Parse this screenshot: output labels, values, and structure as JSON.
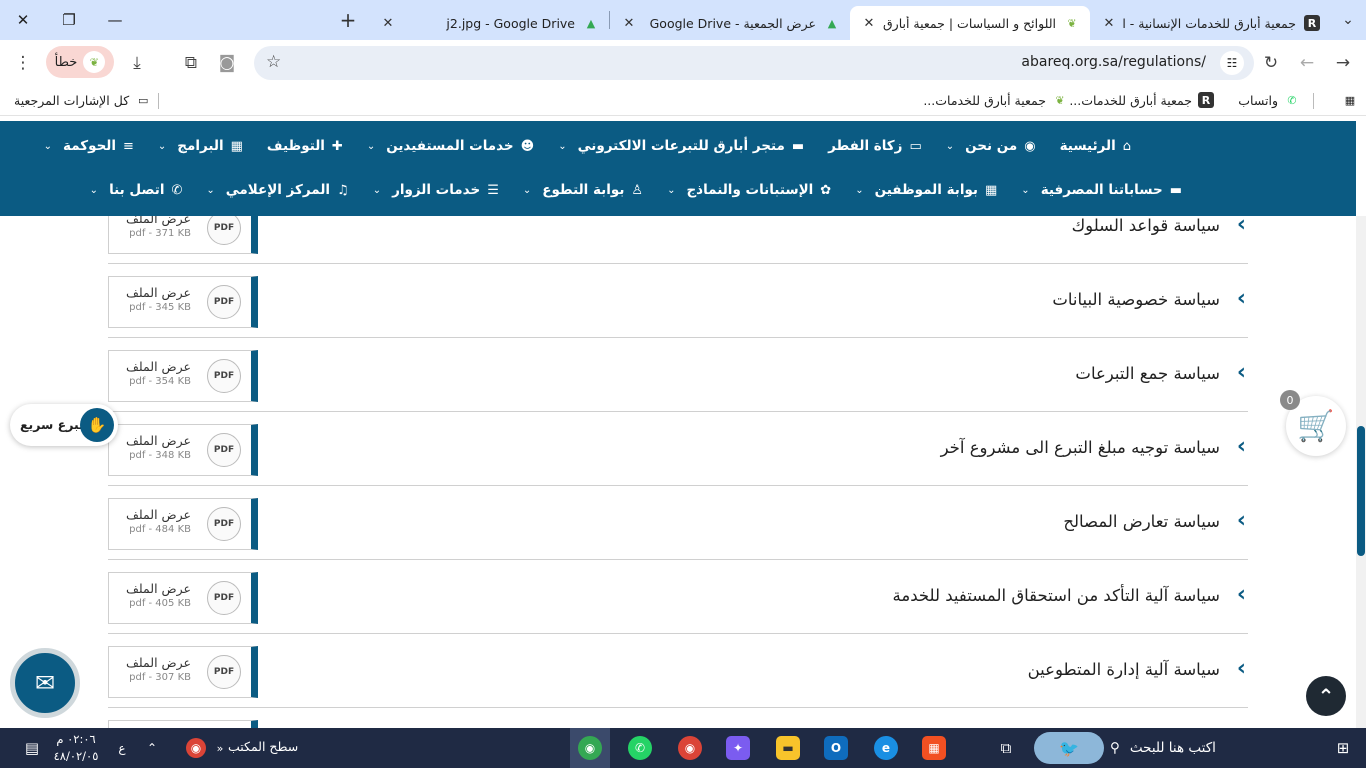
{
  "browser": {
    "tabs": [
      {
        "title": "جمعية أبارق للخدمات الإنسانية - ا",
        "active": false
      },
      {
        "title": "اللوائح و السياسات | جمعية أبارق ا",
        "active": true
      },
      {
        "title": "عرض الجمعية - Google Drive",
        "active": false
      },
      {
        "title": "j2.jpg - Google Drive",
        "active": false
      }
    ],
    "url": "abareq.org.sa/regulations/",
    "error_label": "خطأ",
    "bookmarks": {
      "whatsapp": "واتساب",
      "bm1": "جمعية أبارق للخدمات...",
      "bm2": "جمعية أبارق للخدمات...",
      "all": "كل الإشارات المرجعية"
    }
  },
  "nav": {
    "row1": [
      {
        "label": "الرئيسية",
        "icon": "⌂"
      },
      {
        "label": "من نحن",
        "icon": "◉",
        "dropdown": true
      },
      {
        "label": "زكاة الفطر",
        "icon": "▭"
      },
      {
        "label": "متجر أبارق للتبرعات الالكتروني",
        "icon": "▬",
        "dropdown": true
      },
      {
        "label": "خدمات المستفيدين",
        "icon": "☻",
        "dropdown": true
      },
      {
        "label": "التوظيف",
        "icon": "✚"
      },
      {
        "label": "البرامج",
        "icon": "▦",
        "dropdown": true
      },
      {
        "label": "الحوكمة",
        "icon": "≡",
        "dropdown": true
      }
    ],
    "row2": [
      {
        "label": "حساباتنا المصرفية",
        "icon": "▬",
        "dropdown": true
      },
      {
        "label": "بوابة الموظفين",
        "icon": "▦",
        "dropdown": true
      },
      {
        "label": "الإستبانات والنماذج",
        "icon": "✿",
        "dropdown": true
      },
      {
        "label": "بوابة التطوع",
        "icon": "♙",
        "dropdown": true
      },
      {
        "label": "خدمات الزوار",
        "icon": "☰",
        "dropdown": true
      },
      {
        "label": "المركز الإعلامي",
        "icon": "♫",
        "dropdown": true
      },
      {
        "label": "اتصل بنا",
        "icon": "✆",
        "dropdown": true
      }
    ]
  },
  "file_view_label": "عرض الملف",
  "pdf_label": "PDF",
  "policies": [
    {
      "title": "سياسة قواعد السلوك",
      "size": "pdf - 371 KB"
    },
    {
      "title": "سياسة خصوصية البيانات",
      "size": "pdf - 345 KB"
    },
    {
      "title": "سياسة جمع التبرعات",
      "size": "pdf - 354 KB"
    },
    {
      "title": "سياسة توجيه مبلغ التبرع الى مشروع آخر",
      "size": "pdf - 348 KB"
    },
    {
      "title": "سياسة تعارض المصالح",
      "size": "pdf - 484 KB"
    },
    {
      "title": "سياسة آلية التأكد من استحقاق المستفيد للخدمة",
      "size": "pdf - 405 KB"
    },
    {
      "title": "سياسة آلية إدارة المتطوعين",
      "size": "pdf - 307 KB"
    }
  ],
  "widgets": {
    "quick_donate": "تبرع سريع",
    "cart_count": "0"
  },
  "taskbar": {
    "search_placeholder": "اكتب هنا للبحث",
    "desktop_label": "سطح المكتب",
    "time": "٠٢:٠٦ م",
    "date": "٤٨/٠٢/٠٥",
    "lang": "ع"
  },
  "colors": {
    "brand": "#0b5b83",
    "tabstrip": "#d3e3fd",
    "taskbar": "#1f2a44"
  }
}
